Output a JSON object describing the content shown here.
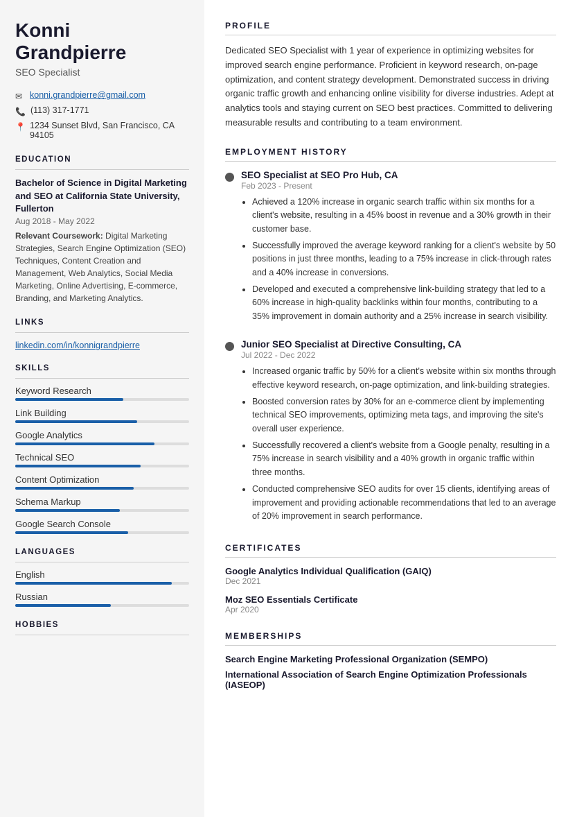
{
  "sidebar": {
    "name": "Konni\nGrandpierre",
    "name_line1": "Konni",
    "name_line2": "Grandpierre",
    "title": "SEO Specialist",
    "contact": {
      "email": "konni.grandpierre@gmail.com",
      "phone": "(113) 317-1771",
      "address": "1234 Sunset Blvd, San Francisco, CA 94105"
    },
    "education": {
      "section_title": "EDUCATION",
      "degree": "Bachelor of Science in Digital Marketing and SEO at California State University, Fullerton",
      "dates": "Aug 2018 - May 2022",
      "coursework_label": "Relevant Coursework:",
      "coursework": "Digital Marketing Strategies, Search Engine Optimization (SEO) Techniques, Content Creation and Management, Web Analytics, Social Media Marketing, Online Advertising, E-commerce, Branding, and Marketing Analytics."
    },
    "links": {
      "section_title": "LINKS",
      "linkedin": "linkedin.com/in/konnigrandpierre"
    },
    "skills": {
      "section_title": "SKILLS",
      "items": [
        {
          "name": "Keyword Research",
          "pct": 62
        },
        {
          "name": "Link Building",
          "pct": 70
        },
        {
          "name": "Google Analytics",
          "pct": 80
        },
        {
          "name": "Technical SEO",
          "pct": 72
        },
        {
          "name": "Content Optimization",
          "pct": 68
        },
        {
          "name": "Schema Markup",
          "pct": 60
        },
        {
          "name": "Google Search Console",
          "pct": 65
        }
      ]
    },
    "languages": {
      "section_title": "LANGUAGES",
      "items": [
        {
          "name": "English",
          "pct": 90
        },
        {
          "name": "Russian",
          "pct": 55
        }
      ]
    },
    "hobbies": {
      "section_title": "HOBBIES"
    }
  },
  "main": {
    "profile": {
      "section_title": "PROFILE",
      "text": "Dedicated SEO Specialist with 1 year of experience in optimizing websites for improved search engine performance. Proficient in keyword research, on-page optimization, and content strategy development. Demonstrated success in driving organic traffic growth and enhancing online visibility for diverse industries. Adept at analytics tools and staying current on SEO best practices. Committed to delivering measurable results and contributing to a team environment."
    },
    "employment": {
      "section_title": "EMPLOYMENT HISTORY",
      "jobs": [
        {
          "title": "SEO Specialist at SEO Pro Hub, CA",
          "dates": "Feb 2023 - Present",
          "bullets": [
            "Achieved a 120% increase in organic search traffic within six months for a client's website, resulting in a 45% boost in revenue and a 30% growth in their customer base.",
            "Successfully improved the average keyword ranking for a client's website by 50 positions in just three months, leading to a 75% increase in click-through rates and a 40% increase in conversions.",
            "Developed and executed a comprehensive link-building strategy that led to a 60% increase in high-quality backlinks within four months, contributing to a 35% improvement in domain authority and a 25% increase in search visibility."
          ]
        },
        {
          "title": "Junior SEO Specialist at Directive Consulting, CA",
          "dates": "Jul 2022 - Dec 2022",
          "bullets": [
            "Increased organic traffic by 50% for a client's website within six months through effective keyword research, on-page optimization, and link-building strategies.",
            "Boosted conversion rates by 30% for an e-commerce client by implementing technical SEO improvements, optimizing meta tags, and improving the site's overall user experience.",
            "Successfully recovered a client's website from a Google penalty, resulting in a 75% increase in search visibility and a 40% growth in organic traffic within three months.",
            "Conducted comprehensive SEO audits for over 15 clients, identifying areas of improvement and providing actionable recommendations that led to an average of 20% improvement in search performance."
          ]
        }
      ]
    },
    "certificates": {
      "section_title": "CERTIFICATES",
      "items": [
        {
          "name": "Google Analytics Individual Qualification (GAIQ)",
          "date": "Dec 2021"
        },
        {
          "name": "Moz SEO Essentials Certificate",
          "date": "Apr 2020"
        }
      ]
    },
    "memberships": {
      "section_title": "MEMBERSHIPS",
      "items": [
        {
          "name": "Search Engine Marketing Professional Organization (SEMPO)"
        },
        {
          "name": "International Association of Search Engine Optimization Professionals (IASEOP)"
        }
      ]
    }
  }
}
